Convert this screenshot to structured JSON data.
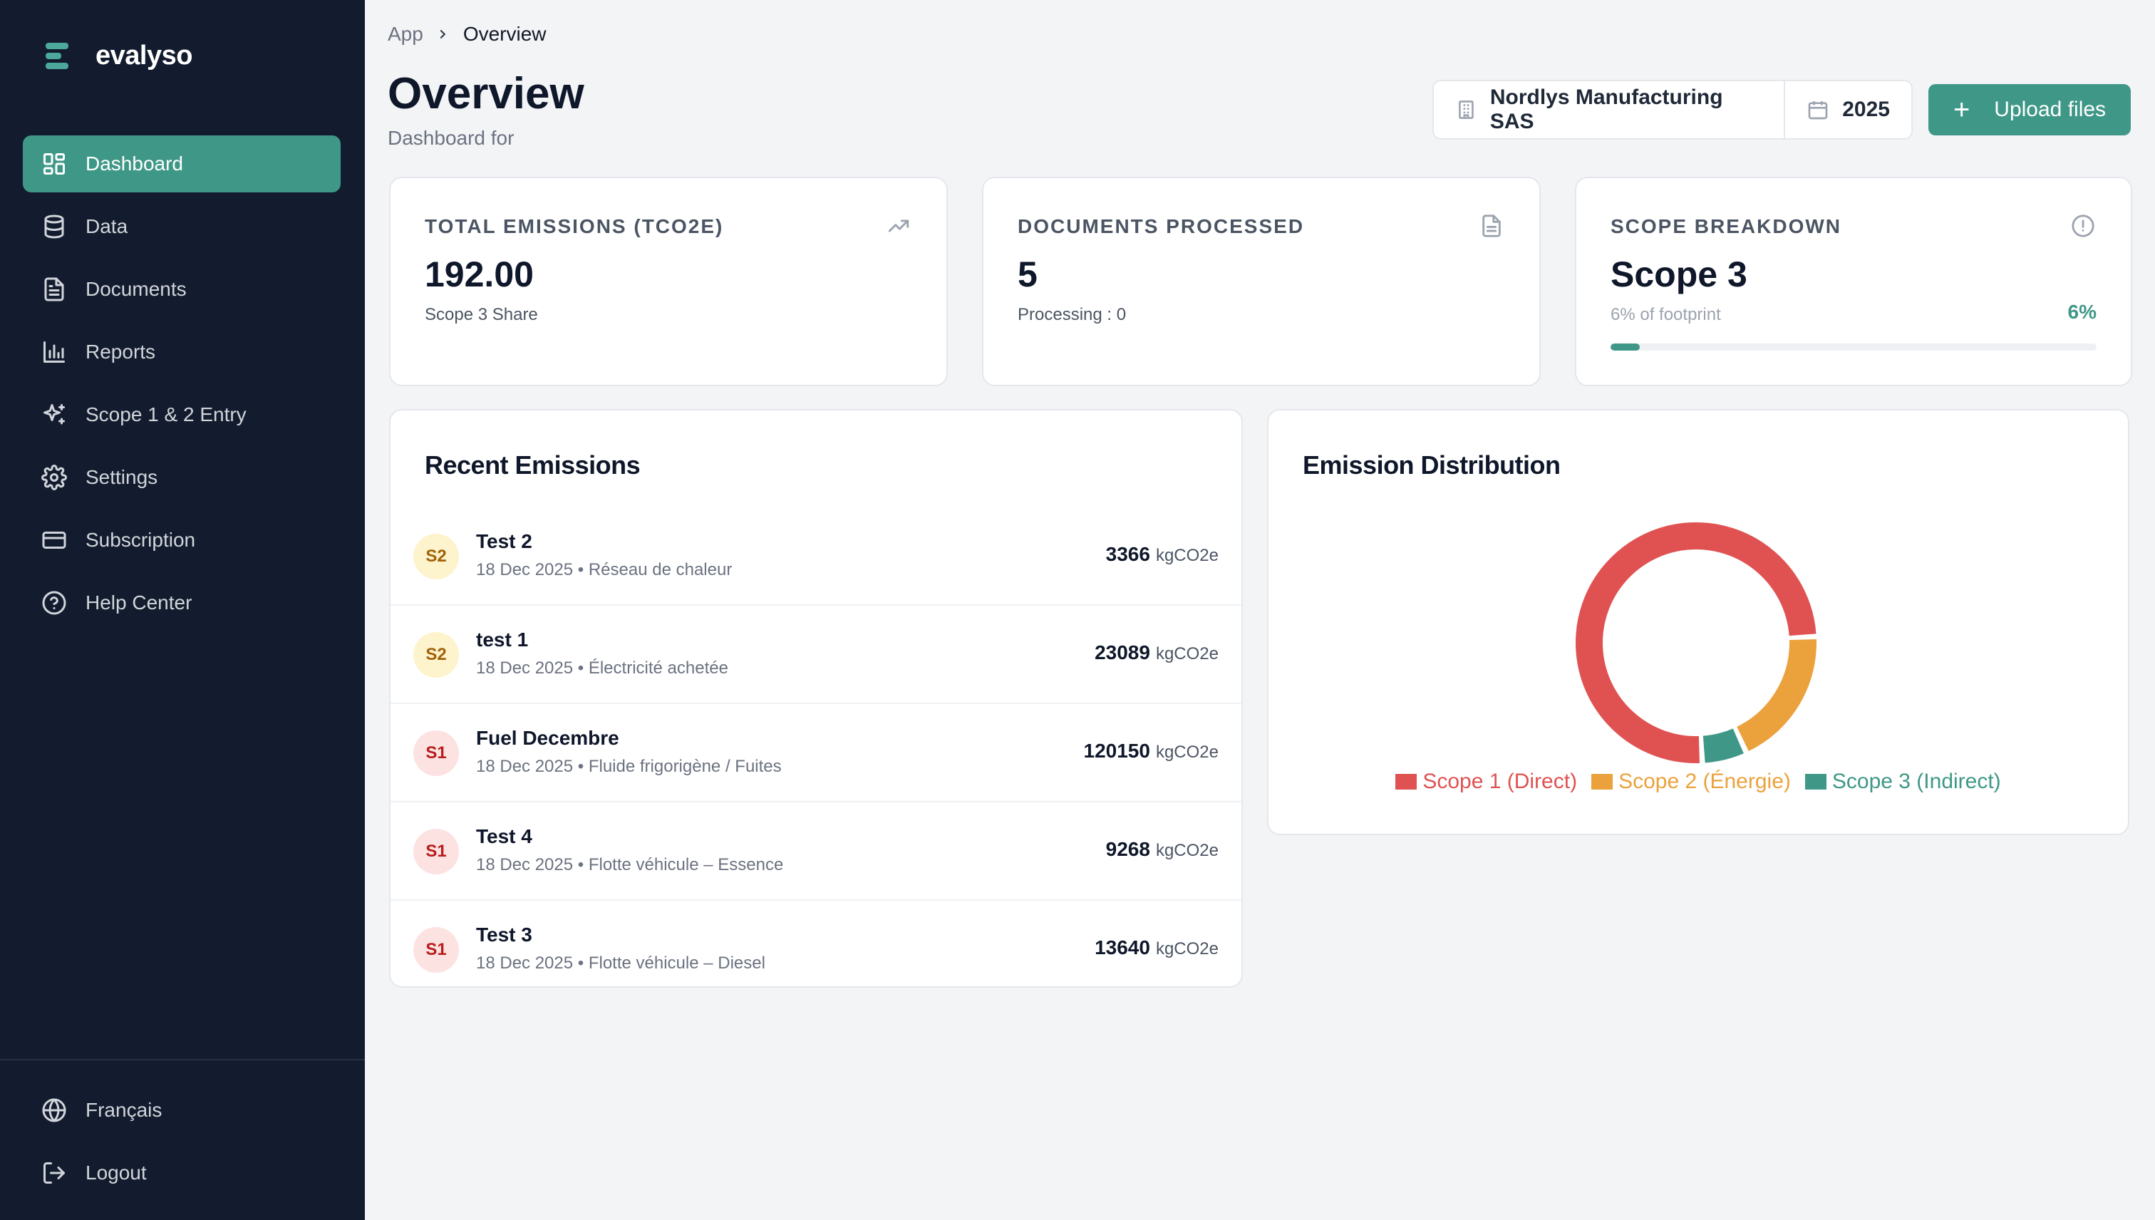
{
  "brand": {
    "name": "evalyso"
  },
  "sidebar": {
    "items": [
      {
        "label": "Dashboard",
        "icon": "dashboard-icon",
        "active": true
      },
      {
        "label": "Data",
        "icon": "database-icon"
      },
      {
        "label": "Documents",
        "icon": "document-icon"
      },
      {
        "label": "Reports",
        "icon": "bar-chart-icon"
      },
      {
        "label": "Scope 1 & 2 Entry",
        "icon": "sparkles-icon"
      },
      {
        "label": "Settings",
        "icon": "gear-icon"
      },
      {
        "label": "Subscription",
        "icon": "credit-card-icon"
      },
      {
        "label": "Help Center",
        "icon": "help-circle-icon"
      }
    ],
    "bottom": [
      {
        "label": "Français",
        "icon": "globe-icon"
      },
      {
        "label": "Logout",
        "icon": "logout-icon"
      }
    ]
  },
  "breadcrumb": {
    "root": "App",
    "current": "Overview"
  },
  "header": {
    "title": "Overview",
    "subtitle": "Dashboard for",
    "company": "Nordlys Manufacturing SAS",
    "year": "2025",
    "upload_label": "Upload files"
  },
  "stats": {
    "total": {
      "label": "TOTAL EMISSIONS (TCO2E)",
      "value": "192.00",
      "sub": "Scope 3 Share"
    },
    "documents": {
      "label": "DOCUMENTS PROCESSED",
      "value": "5",
      "sub": "Processing : 0"
    },
    "scope": {
      "label": "SCOPE BREAKDOWN",
      "value": "Scope 3",
      "sub": "6% of footprint",
      "percent_label": "6%",
      "percent": 6
    }
  },
  "recent": {
    "title": "Recent Emissions",
    "unit": "kgCO2e",
    "items": [
      {
        "badge": "S2",
        "name": "Test 2",
        "meta": "18 Dec 2025 • Réseau de chaleur",
        "value": "3366"
      },
      {
        "badge": "S2",
        "name": "test 1",
        "meta": "18 Dec 2025 • Électricité achetée",
        "value": "23089"
      },
      {
        "badge": "S1",
        "name": "Fuel Decembre",
        "meta": "18 Dec 2025 • Fluide frigorigène / Fuites",
        "value": "120150"
      },
      {
        "badge": "S1",
        "name": "Test 4",
        "meta": "18 Dec 2025 • Flotte véhicule – Essence",
        "value": "9268"
      },
      {
        "badge": "S1",
        "name": "Test 3",
        "meta": "18 Dec 2025 • Flotte véhicule – Diesel",
        "value": "13640"
      }
    ]
  },
  "distribution": {
    "title": "Emission Distribution",
    "colors": {
      "scope1": "#e05252",
      "scope2": "#eba23c",
      "scope3": "#3f9887"
    }
  },
  "chart_data": {
    "type": "pie",
    "title": "Emission Distribution",
    "categories": [
      "Scope 1 (Direct)",
      "Scope 2 (Énergie)",
      "Scope 3 (Indirect)"
    ],
    "values": [
      75,
      19,
      6
    ],
    "legend": "bottom"
  }
}
